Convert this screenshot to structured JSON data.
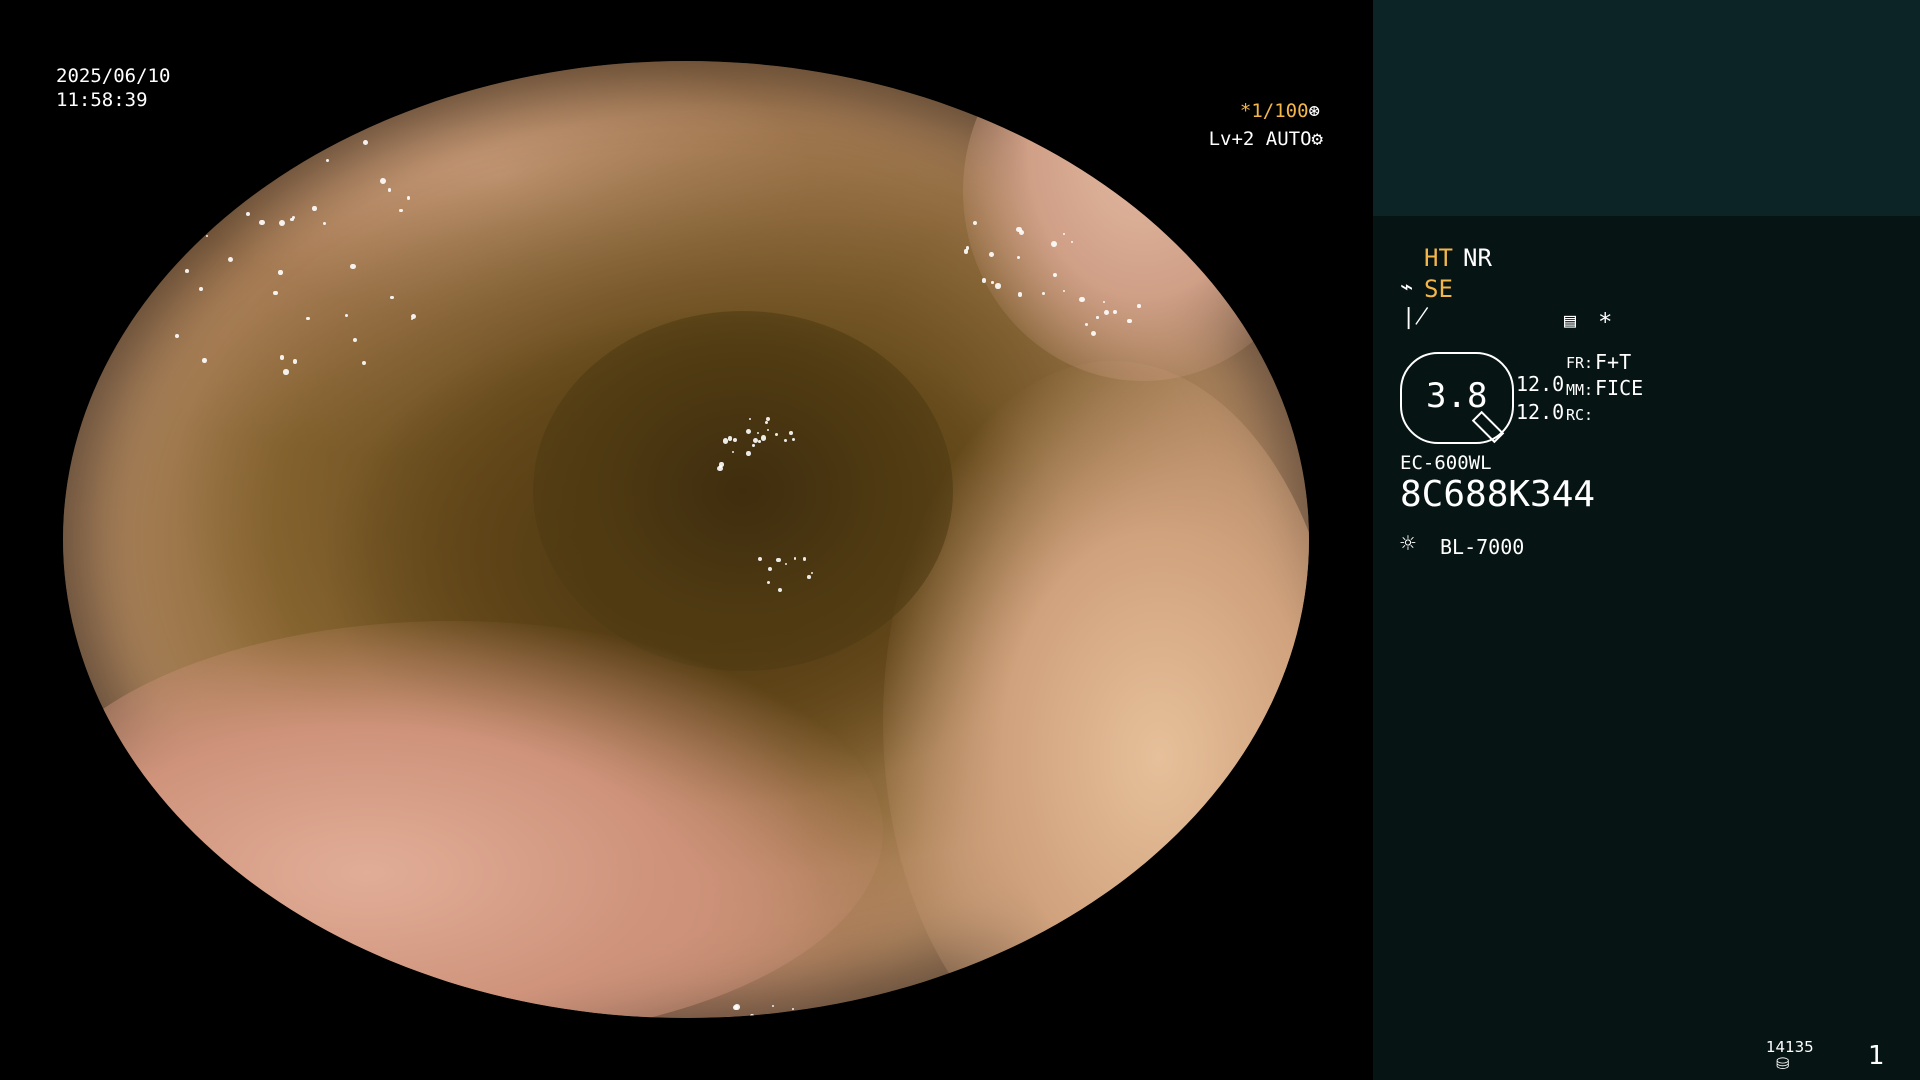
{
  "image": {
    "date": "2025/06/10",
    "time": "11:58:39",
    "shutter": "*1/100",
    "shutter_icon": "aperture-icon",
    "level": "Lv+2 AUTO",
    "auto_icon": "gear-icon"
  },
  "panel": {
    "ht": "HT",
    "nr": "NR",
    "se": "SE",
    "se_icon": "wave-icon",
    "slash_icon": "slash-icon",
    "settings_icon": "settings-icon",
    "star": "*",
    "ring_value": "3.8",
    "val1": "12.0",
    "val2": "12.0",
    "fr_label": "FR:",
    "fr_value": "F+T",
    "mm_label": "MM:",
    "mm_value": "FICE",
    "rc_label": "RC:",
    "scope_model": "EC-600WL",
    "serial": "8C688K344",
    "light_icon": "sun-icon",
    "light_source": "BL-7000",
    "storage_count": "14135",
    "storage_icon": "disk-icon",
    "page": "1"
  },
  "colors": {
    "accent": "#f2b64a",
    "panel_top": "#0c2426",
    "panel_bottom": "#071414"
  }
}
